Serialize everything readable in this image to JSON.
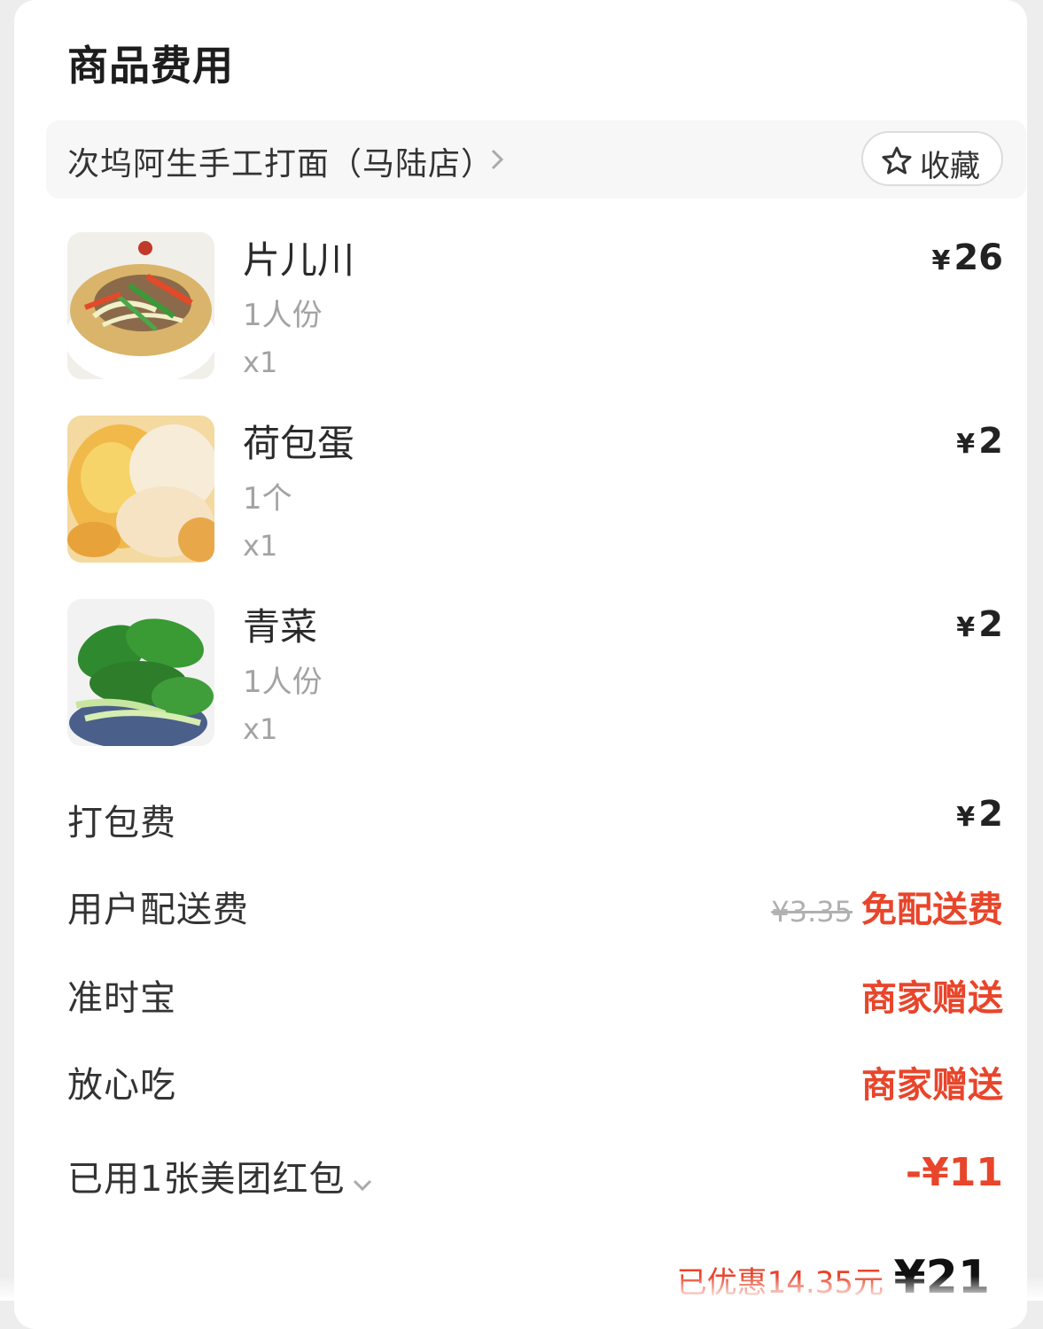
{
  "section": {
    "title": "商品费用"
  },
  "store": {
    "name": "次坞阿生手工打面（马陆店）",
    "favorite_label": "收藏"
  },
  "items": [
    {
      "name": "片儿川",
      "spec": "1人份",
      "qty": "x1",
      "currency": "¥",
      "price": "26",
      "thumb_icon": "noodle-soup-image"
    },
    {
      "name": "荷包蛋",
      "spec": "1个",
      "qty": "x1",
      "currency": "¥",
      "price": "2",
      "thumb_icon": "fried-egg-image"
    },
    {
      "name": "青菜",
      "spec": "1人份",
      "qty": "x1",
      "currency": "¥",
      "price": "2",
      "thumb_icon": "bok-choy-image"
    }
  ],
  "fees": {
    "packaging": {
      "label": "打包费",
      "currency": "¥",
      "value": "2"
    },
    "delivery": {
      "label": "用户配送费",
      "original": "¥3.35",
      "value": "免配送费"
    },
    "ontime": {
      "label": "准时宝",
      "value": "商家赠送"
    },
    "safe_eat": {
      "label": "放心吃",
      "value": "商家赠送"
    },
    "coupon": {
      "label": "已用1张美团红包",
      "value": "-¥11"
    }
  },
  "summary": {
    "saved": "已优惠14.35元",
    "total": "¥21"
  },
  "colors": {
    "accent_red": "#e8452b",
    "muted_text": "#a3a3a3"
  }
}
